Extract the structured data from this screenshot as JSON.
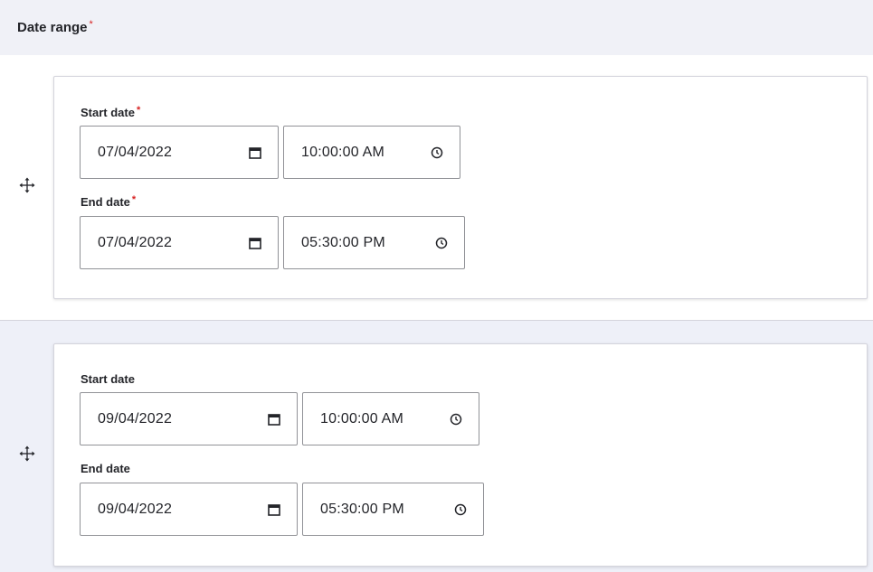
{
  "header": {
    "title": "Date range",
    "required_mark": "*"
  },
  "ranges": [
    {
      "start_label": "Start date",
      "start_required": "*",
      "start_date": "07/04/2022",
      "start_time": "10:00:00 AM",
      "end_label": "End date",
      "end_required": "*",
      "end_date": "07/04/2022",
      "end_time": "05:30:00 PM"
    },
    {
      "start_label": "Start date",
      "start_date": "09/04/2022",
      "start_time": "10:00:00 AM",
      "end_label": "End date",
      "end_date": "09/04/2022",
      "end_time": "05:30:00 PM"
    }
  ],
  "icons": {
    "drag": "move-icon",
    "date": "calendar-icon",
    "time": "clock-icon"
  },
  "colors": {
    "header_bg": "#f0f1f7",
    "row_alt_bg": "#eef0f8",
    "required": "#d72222",
    "input_border": "#919297"
  }
}
